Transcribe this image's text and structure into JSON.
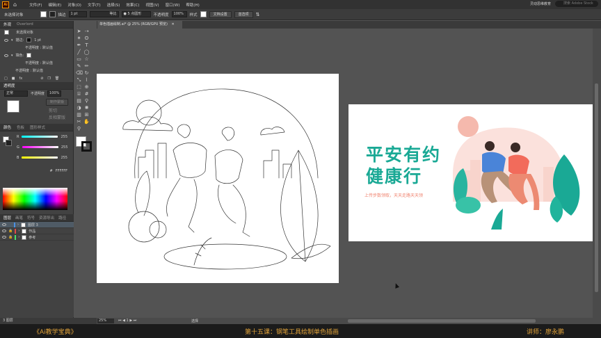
{
  "menubar": {
    "items": [
      "文件(F)",
      "编辑(E)",
      "对象(O)",
      "文字(T)",
      "选择(S)",
      "效果(C)",
      "视图(V)",
      "窗口(W)",
      "帮助(H)"
    ],
    "workspace": "灵动思维教育",
    "search_placeholder": "搜索 Adobe Stock"
  },
  "control": {
    "selection": "未选择对象",
    "stroke_label": "描边",
    "stroke_weight": "1 pt",
    "brush_label": "等比",
    "brush_name": "5 点圆形",
    "opacity_label": "不透明度",
    "opacity_value": "100%",
    "style_label": "样式",
    "doc_setup": "文档设置",
    "prefs": "首选项"
  },
  "left_panel": {
    "appearance_tabs": [
      "外观",
      "Overlord"
    ],
    "appearance_title": "未选择对象",
    "stroke_row": "描边:",
    "stroke_value": "1 pt",
    "opacity_row": "不透明度 : 默认值",
    "fill_row": "填色:",
    "transparency_tab": "透明度",
    "blend_mode": "正常",
    "transparency_opacity_label": "不透明度",
    "transparency_opacity": "100%",
    "make_mask": "制作蒙版",
    "clip": "剪切",
    "invert_mask": "反相蒙版",
    "color_tabs": [
      "颜色",
      "色板",
      "图形样式"
    ],
    "color_channels": [
      {
        "name": "R",
        "value": "255"
      },
      {
        "name": "G",
        "value": "255"
      },
      {
        "name": "B",
        "value": "255"
      }
    ],
    "hex": "FFFFFF",
    "layer_tabs": [
      "图层",
      "画笔",
      "符号",
      "资源导出",
      "路径"
    ],
    "layers": [
      {
        "name": "图层 3",
        "selected": true,
        "color": "#4a90e2"
      },
      {
        "name": "作品",
        "selected": false,
        "color": "#e24a4a"
      },
      {
        "name": "参考",
        "selected": false,
        "color": "#4ae26a"
      }
    ],
    "layer_count": "3 图层"
  },
  "document": {
    "tab_title": "单色插画绘制.ai* @ 25% (RGB/GPU 预览)"
  },
  "reference": {
    "title_line1": "平安有约",
    "title_line2": "健康行",
    "subtitle": "上传步数领取，天天走路天天领"
  },
  "status": {
    "zoom": "25%",
    "page": "1",
    "tool": "选择"
  },
  "course": {
    "series": "《Ai教学宝典》",
    "lesson": "第十五课：钢笔工具绘制单色插画",
    "teacher": "讲师：廖永鹏"
  },
  "colors": {
    "teal": "#1aa995",
    "coral": "#f08470",
    "gold": "#e2a33a",
    "canvas_bg": "#535353"
  }
}
